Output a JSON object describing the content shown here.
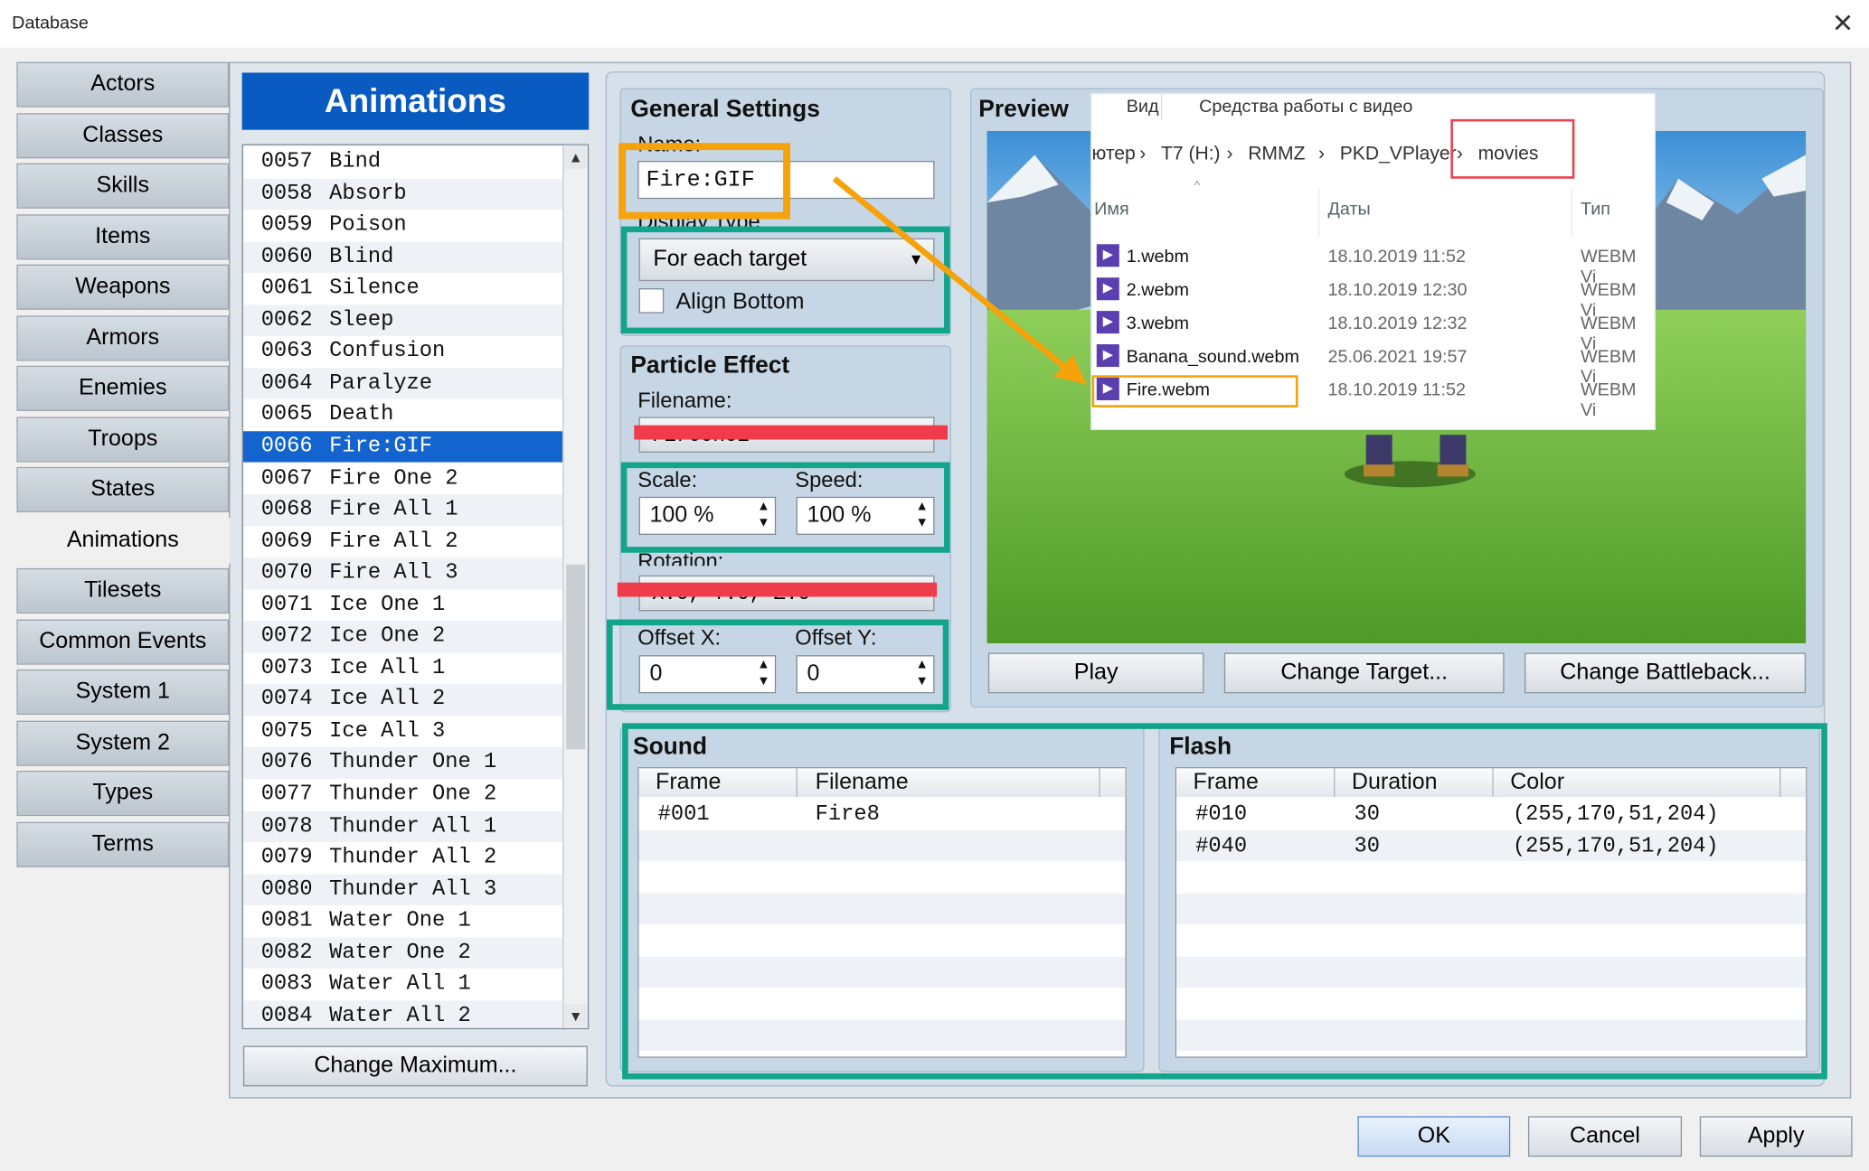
{
  "window": {
    "title": "Database",
    "close_icon": "close-icon"
  },
  "tabs": [
    "Actors",
    "Classes",
    "Skills",
    "Items",
    "Weapons",
    "Armors",
    "Enemies",
    "Troops",
    "States",
    "Animations",
    "Tilesets",
    "Common Events",
    "System 1",
    "System 2",
    "Types",
    "Terms"
  ],
  "selected_tab": "Animations",
  "list": {
    "header": "Animations",
    "items": [
      {
        "id": "0057",
        "name": "Bind"
      },
      {
        "id": "0058",
        "name": "Absorb"
      },
      {
        "id": "0059",
        "name": "Poison"
      },
      {
        "id": "0060",
        "name": "Blind"
      },
      {
        "id": "0061",
        "name": "Silence"
      },
      {
        "id": "0062",
        "name": "Sleep"
      },
      {
        "id": "0063",
        "name": "Confusion"
      },
      {
        "id": "0064",
        "name": "Paralyze"
      },
      {
        "id": "0065",
        "name": "Death"
      },
      {
        "id": "0066",
        "name": "Fire:GIF"
      },
      {
        "id": "0067",
        "name": "Fire One 2"
      },
      {
        "id": "0068",
        "name": "Fire All 1"
      },
      {
        "id": "0069",
        "name": "Fire All 2"
      },
      {
        "id": "0070",
        "name": "Fire All 3"
      },
      {
        "id": "0071",
        "name": "Ice One 1"
      },
      {
        "id": "0072",
        "name": "Ice One 2"
      },
      {
        "id": "0073",
        "name": "Ice All 1"
      },
      {
        "id": "0074",
        "name": "Ice All 2"
      },
      {
        "id": "0075",
        "name": "Ice All 3"
      },
      {
        "id": "0076",
        "name": "Thunder One 1"
      },
      {
        "id": "0077",
        "name": "Thunder One 2"
      },
      {
        "id": "0078",
        "name": "Thunder All 1"
      },
      {
        "id": "0079",
        "name": "Thunder All 2"
      },
      {
        "id": "0080",
        "name": "Thunder All 3"
      },
      {
        "id": "0081",
        "name": "Water One 1"
      },
      {
        "id": "0082",
        "name": "Water One 2"
      },
      {
        "id": "0083",
        "name": "Water All 1"
      },
      {
        "id": "0084",
        "name": "Water All 2"
      }
    ],
    "selected_id": "0066",
    "change_max_label": "Change Maximum..."
  },
  "general": {
    "header": "General Settings",
    "name_label": "Name:",
    "name_value": "Fire:GIF",
    "display_type_label": "Display Type:",
    "display_type_value": "For each target",
    "align_bottom_label": "Align Bottom",
    "align_bottom_checked": false
  },
  "particle": {
    "header": "Particle Effect",
    "filename_label": "Filename:",
    "filename_value": "FireOne1",
    "scale_label": "Scale:",
    "scale_value": "100 %",
    "speed_label": "Speed:",
    "speed_value": "100 %",
    "rotation_label": "Rotation:",
    "rotation_value": "X:0, Y:0, Z:0",
    "offset_x_label": "Offset X:",
    "offset_x_value": "0",
    "offset_y_label": "Offset Y:",
    "offset_y_value": "0"
  },
  "preview": {
    "header": "Preview",
    "play_label": "Play",
    "change_target_label": "Change Target...",
    "change_battleback_label": "Change Battleback..."
  },
  "explorer": {
    "menu": [
      "Вид",
      "Средства работы с видео"
    ],
    "breadcrumb": [
      "ютер",
      "T7 (H:)",
      "RMMZ",
      "PKD_VPlayer",
      "movies"
    ],
    "columns": [
      "Имя",
      "Даты",
      "Тип"
    ],
    "files": [
      {
        "name": "1.webm",
        "date": "18.10.2019 11:52",
        "type": "WEBM Vi"
      },
      {
        "name": "2.webm",
        "date": "18.10.2019 12:30",
        "type": "WEBM Vi"
      },
      {
        "name": "3.webm",
        "date": "18.10.2019 12:32",
        "type": "WEBM Vi"
      },
      {
        "name": "Banana_sound.webm",
        "date": "25.06.2021 19:57",
        "type": "WEBM Vi"
      },
      {
        "name": "Fire.webm",
        "date": "18.10.2019 11:52",
        "type": "WEBM Vi"
      }
    ]
  },
  "sound": {
    "header": "Sound",
    "columns": [
      "Frame",
      "Filename"
    ],
    "rows": [
      {
        "frame": "#001",
        "filename": "Fire8"
      }
    ]
  },
  "flash": {
    "header": "Flash",
    "columns": [
      "Frame",
      "Duration",
      "Color"
    ],
    "rows": [
      {
        "frame": "#010",
        "duration": "30",
        "color": "(255,170,51,204)"
      },
      {
        "frame": "#040",
        "duration": "30",
        "color": "(255,170,51,204)"
      }
    ]
  },
  "footer": {
    "ok": "OK",
    "cancel": "Cancel",
    "apply": "Apply"
  },
  "colors": {
    "highlight_green": "#13a58a",
    "highlight_orange": "#f5a20b",
    "highlight_red": "#f03c4a",
    "selection_blue": "#1464cf"
  }
}
